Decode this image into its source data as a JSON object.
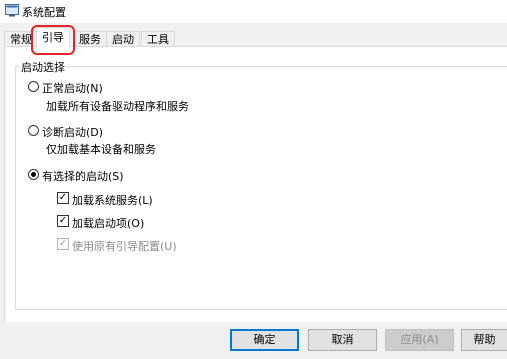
{
  "window": {
    "title": "系统配置",
    "icon": "msconfig-icon"
  },
  "tabs": [
    {
      "label": "常规",
      "selected": false
    },
    {
      "label": "引导",
      "selected": true,
      "highlighted": true
    },
    {
      "label": "服务",
      "selected": false
    },
    {
      "label": "启动",
      "selected": false
    },
    {
      "label": "工具",
      "selected": false
    }
  ],
  "startup_selection": {
    "group_label": "启动选择",
    "normal": {
      "label": "正常启动(N)",
      "description": "加载所有设备驱动程序和服务",
      "selected": false
    },
    "diagnostic": {
      "label": "诊断启动(D)",
      "description": "仅加载基本设备和服务",
      "selected": false
    },
    "selective": {
      "label": "有选择的启动(S)",
      "selected": true,
      "options": [
        {
          "label": "加载系统服务(L)",
          "checked": true,
          "enabled": true
        },
        {
          "label": "加载启动项(O)",
          "checked": true,
          "enabled": true
        },
        {
          "label": "使用原有引导配置(U)",
          "checked": true,
          "enabled": false
        }
      ]
    }
  },
  "buttons": {
    "ok": "确定",
    "cancel": "取消",
    "apply": "应用(A)",
    "help": "帮助"
  },
  "colors": {
    "highlight": "#e0262b",
    "default_button_border": "#0078d7"
  }
}
